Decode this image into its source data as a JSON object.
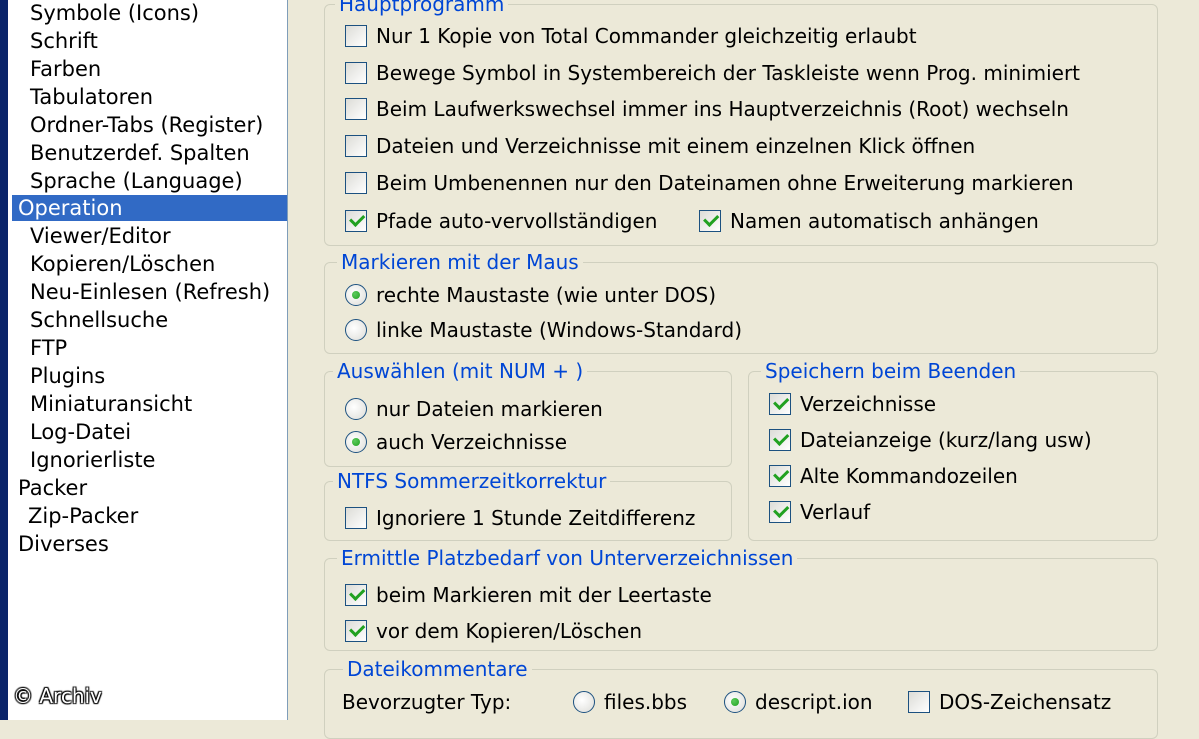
{
  "tree": {
    "items": [
      {
        "label": "Symbole (Icons)"
      },
      {
        "label": "Schrift"
      },
      {
        "label": "Farben"
      },
      {
        "label": "Tabulatoren"
      },
      {
        "label": "Ordner-Tabs (Register)"
      },
      {
        "label": "Benutzerdef. Spalten"
      },
      {
        "label": "Sprache (Language)"
      },
      {
        "label": "Operation",
        "selected": true
      },
      {
        "label": "Viewer/Editor"
      },
      {
        "label": "Kopieren/Löschen"
      },
      {
        "label": "Neu-Einlesen (Refresh)"
      },
      {
        "label": "Schnellsuche"
      },
      {
        "label": "FTP"
      },
      {
        "label": "Plugins"
      },
      {
        "label": "Miniaturansicht"
      },
      {
        "label": "Log-Datei"
      },
      {
        "label": "Ignorierliste"
      },
      {
        "label": "Packer"
      },
      {
        "label": "Zip-Packer"
      },
      {
        "label": "Diverses"
      }
    ]
  },
  "watermark": "© Archiv",
  "hauptprogramm": {
    "title": "Hauptprogramm",
    "options": [
      {
        "label": "Nur 1 Kopie von Total Commander gleichzeitig erlaubt",
        "checked": false
      },
      {
        "label": "Bewege Symbol in Systembereich der Taskleiste wenn Prog. minimiert",
        "checked": false
      },
      {
        "label": "Beim Laufwerkswechsel immer ins Hauptverzeichnis (Root) wechseln",
        "checked": false
      },
      {
        "label": "Dateien und Verzeichnisse mit einem einzelnen Klick öffnen",
        "checked": false
      },
      {
        "label": "Beim Umbenennen nur den Dateinamen ohne Erweiterung markieren",
        "checked": false
      },
      {
        "label": "Pfade auto-vervollständigen",
        "checked": true
      },
      {
        "label": "Namen automatisch anhängen",
        "checked": true
      }
    ]
  },
  "maus": {
    "title": "Markieren mit der Maus",
    "options": [
      {
        "label": "rechte Maustaste (wie unter DOS)",
        "selected": true
      },
      {
        "label": "linke Maustaste (Windows-Standard)",
        "selected": false
      }
    ]
  },
  "auswaehlen": {
    "title": "Auswählen (mit NUM + )",
    "options": [
      {
        "label": "nur Dateien markieren",
        "selected": false
      },
      {
        "label": "auch Verzeichnisse",
        "selected": true
      }
    ]
  },
  "speichern": {
    "title": "Speichern beim Beenden",
    "options": [
      {
        "label": "Verzeichnisse",
        "checked": true
      },
      {
        "label": "Dateianzeige (kurz/lang usw)",
        "checked": true
      },
      {
        "label": "Alte Kommandozeilen",
        "checked": true
      },
      {
        "label": "Verlauf",
        "checked": true
      }
    ]
  },
  "ntfs": {
    "title": "NTFS Sommerzeitkorrektur",
    "options": [
      {
        "label": "Ignoriere 1 Stunde Zeitdifferenz",
        "checked": false
      }
    ]
  },
  "platz": {
    "title": "Ermittle Platzbedarf von Unterverzeichnissen",
    "options": [
      {
        "label": "beim Markieren mit der Leertaste",
        "checked": true
      },
      {
        "label": "vor dem Kopieren/Löschen",
        "checked": true
      }
    ]
  },
  "kommentare": {
    "title": "Dateikommentare",
    "type_label": "Bevorzugter Typ:",
    "options": [
      {
        "label": "files.bbs",
        "selected": false
      },
      {
        "label": "descript.ion",
        "selected": true
      }
    ],
    "dos_label": "DOS-Zeichensatz",
    "dos_checked": false
  }
}
